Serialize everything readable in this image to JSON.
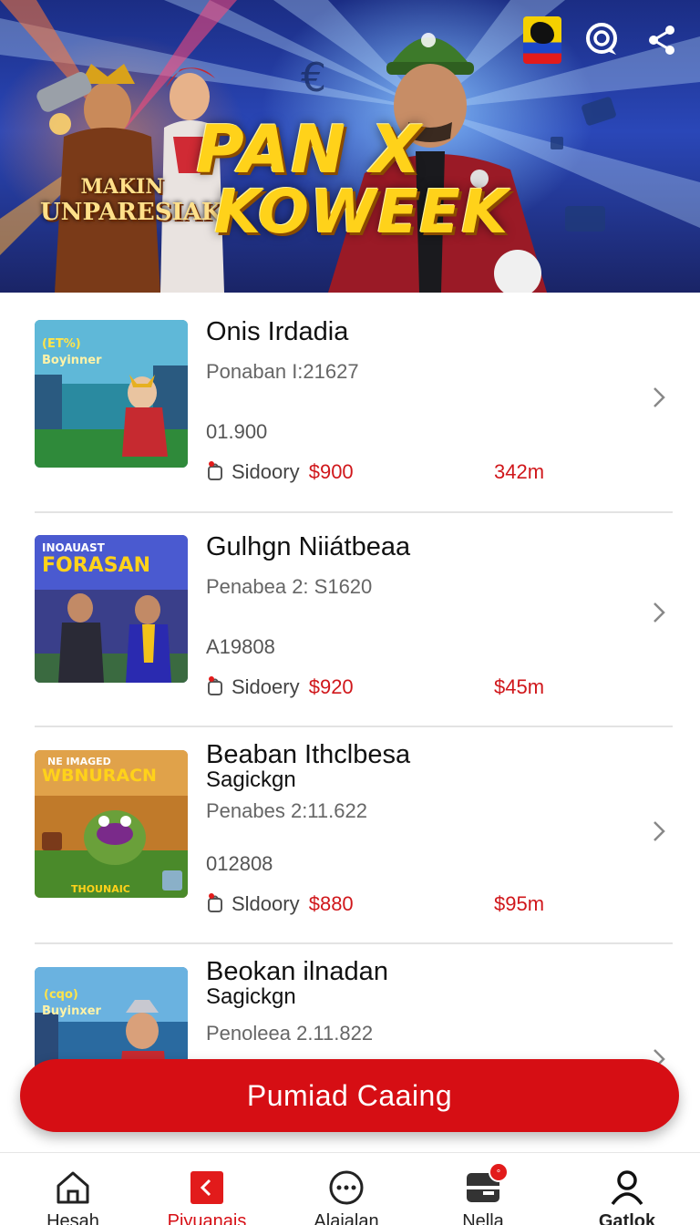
{
  "banner": {
    "title_line1": "PAN X",
    "title_line2": "KOWEEK",
    "badge_line1": "MAKIN",
    "badge_line2": "UNPARESIAK"
  },
  "header_icons": [
    "flag-icon",
    "chat-icon",
    "share-icon"
  ],
  "list": [
    {
      "title": "Onis Irdadia",
      "subtitle": "",
      "meta": "Ponaban І:21627",
      "code": "01.900",
      "seller_label": "Sidoory",
      "price": "$900",
      "right_value": "342m",
      "thumb_caption_top": "(ET%)",
      "thumb_caption_sub": "Boyinner"
    },
    {
      "title": "Gulhgn Niiátbeaa",
      "subtitle": "",
      "meta": "Penabea 2: S1620",
      "code": "A19808",
      "seller_label": "Sidoery",
      "price": "$920",
      "right_value": "$45m",
      "thumb_caption_top": "INOAUAST",
      "thumb_caption_sub": "FORASAN"
    },
    {
      "title": "Beaban Ithclbesa",
      "subtitle": "Sagickgn",
      "meta": "Penabes 2:11.622",
      "code": "012808",
      "seller_label": "Sldoory",
      "price": "$880",
      "right_value": "$95m",
      "thumb_caption_top": "NE IMAGED",
      "thumb_caption_sub": "WBNURACN",
      "thumb_caption_bottom": "THOUNAIC"
    },
    {
      "title": "Beokan ilnadan",
      "subtitle": "Sagickgn",
      "meta": "Penoleea 2.11.822",
      "code": "",
      "seller_label": "",
      "price": "",
      "right_value": "",
      "thumb_caption_top": "(cqo)",
      "thumb_caption_sub": "Buyinxer"
    }
  ],
  "cta": {
    "label": "Pumiad Caaing"
  },
  "nav": [
    {
      "label": "Hesah",
      "icon": "home-icon"
    },
    {
      "label": "Piyuanais",
      "icon": "back-square-icon",
      "active": true
    },
    {
      "label": "Alajalan",
      "icon": "more-circle-icon"
    },
    {
      "label": "Nella",
      "icon": "inbox-icon",
      "badge": "°"
    },
    {
      "label": "Gatlok",
      "icon": "profile-icon"
    }
  ],
  "colors": {
    "accent": "#d60e14",
    "price": "#d0171b",
    "banner_blue": "#2a47b8",
    "title_gold": "#ffd21a"
  }
}
